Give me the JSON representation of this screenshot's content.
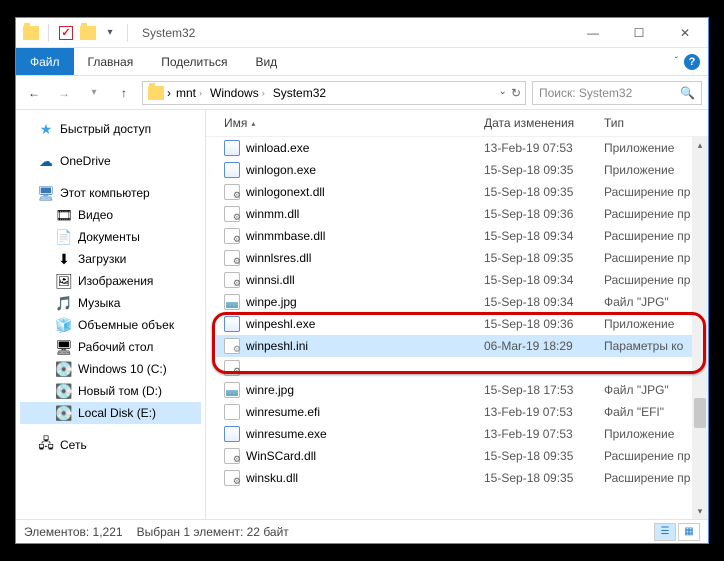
{
  "window": {
    "title": "System32"
  },
  "ribbon": {
    "file": "Файл",
    "tabs": [
      "Главная",
      "Поделиться",
      "Вид"
    ]
  },
  "address": {
    "segments": [
      "mnt",
      "Windows",
      "System32"
    ],
    "search_placeholder": "Поиск: System32"
  },
  "nav": {
    "quick": "Быстрый доступ",
    "onedrive": "OneDrive",
    "thispc": "Этот компьютер",
    "items": [
      {
        "label": "Видео"
      },
      {
        "label": "Документы"
      },
      {
        "label": "Загрузки"
      },
      {
        "label": "Изображения"
      },
      {
        "label": "Музыка"
      },
      {
        "label": "Объемные объек"
      },
      {
        "label": "Рабочий стол"
      },
      {
        "label": "Windows 10 (C:)"
      },
      {
        "label": "Новый том (D:)"
      },
      {
        "label": "Local Disk (E:)"
      }
    ],
    "network": "Сеть"
  },
  "columns": {
    "name": "Имя",
    "date": "Дата изменения",
    "type": "Тип"
  },
  "files": [
    {
      "name": "winload.exe",
      "date": "13-Feb-19 07:53",
      "type": "Приложение",
      "ico": "exe"
    },
    {
      "name": "winlogon.exe",
      "date": "15-Sep-18 09:35",
      "type": "Приложение",
      "ico": "exe"
    },
    {
      "name": "winlogonext.dll",
      "date": "15-Sep-18 09:35",
      "type": "Расширение пр",
      "ico": "dll"
    },
    {
      "name": "winmm.dll",
      "date": "15-Sep-18 09:36",
      "type": "Расширение пр",
      "ico": "dll"
    },
    {
      "name": "winmmbase.dll",
      "date": "15-Sep-18 09:34",
      "type": "Расширение пр",
      "ico": "dll"
    },
    {
      "name": "winnlsres.dll",
      "date": "15-Sep-18 09:35",
      "type": "Расширение пр",
      "ico": "dll"
    },
    {
      "name": "winnsi.dll",
      "date": "15-Sep-18 09:34",
      "type": "Расширение пр",
      "ico": "dll"
    },
    {
      "name": "winpe.jpg",
      "date": "15-Sep-18 09:34",
      "type": "Файл \"JPG\"",
      "ico": "jpg"
    },
    {
      "name": "winpeshl.exe",
      "date": "15-Sep-18 09:36",
      "type": "Приложение",
      "ico": "exe"
    },
    {
      "name": "winpeshl.ini",
      "date": "06-Mar-19 18:29",
      "type": "Параметры ко",
      "ico": "ini",
      "selected": true
    },
    {
      "name": "",
      "date": "",
      "type": "",
      "ico": "dll"
    },
    {
      "name": "winre.jpg",
      "date": "15-Sep-18 17:53",
      "type": "Файл \"JPG\"",
      "ico": "jpg"
    },
    {
      "name": "winresume.efi",
      "date": "13-Feb-19 07:53",
      "type": "Файл \"EFI\"",
      "ico": "efi"
    },
    {
      "name": "winresume.exe",
      "date": "13-Feb-19 07:53",
      "type": "Приложение",
      "ico": "exe"
    },
    {
      "name": "WinSCard.dll",
      "date": "15-Sep-18 09:35",
      "type": "Расширение пр",
      "ico": "dll"
    },
    {
      "name": "winsku.dll",
      "date": "15-Sep-18 09:35",
      "type": "Расширение пр",
      "ico": "dll"
    }
  ],
  "status": {
    "count": "Элементов: 1,221",
    "selection": "Выбран 1 элемент: 22 байт"
  }
}
